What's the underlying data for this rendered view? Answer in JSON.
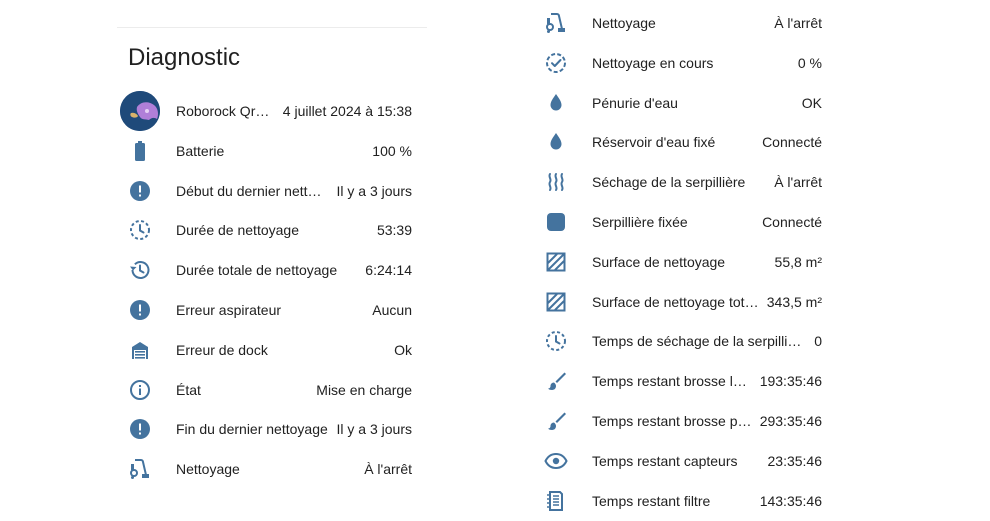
{
  "page": {
    "title": "Diagnostic"
  },
  "colors": {
    "icon": "#44739e",
    "avatar_bg": "#1f4a7a",
    "avatar_accent": "#b07fd8"
  },
  "left": {
    "items": [
      {
        "icon": "robot-avatar",
        "label": "Roborock Qrevo",
        "value": "4 juillet 2024 à 15:38"
      },
      {
        "icon": "battery-icon",
        "label": "Batterie",
        "value": "100 %"
      },
      {
        "icon": "alert-circle-icon",
        "label": "Début du dernier nettoyage",
        "value": "Il y a 3 jours"
      },
      {
        "icon": "timer-outline-icon",
        "label": "Durée de nettoyage",
        "value": "53:39"
      },
      {
        "icon": "history-icon",
        "label": "Durée totale de nettoyage",
        "value": "6:24:14"
      },
      {
        "icon": "alert-circle-icon",
        "label": "Erreur aspirateur",
        "value": "Aucun"
      },
      {
        "icon": "garage-icon",
        "label": "Erreur de dock",
        "value": "Ok"
      },
      {
        "icon": "info-outline-icon",
        "label": "État",
        "value": "Mise en charge"
      },
      {
        "icon": "alert-circle-icon",
        "label": "Fin du dernier nettoyage",
        "value": "Il y a 3 jours"
      },
      {
        "icon": "vacuum-icon",
        "label": "Nettoyage",
        "value": "À l'arrêt"
      }
    ]
  },
  "right": {
    "items": [
      {
        "icon": "vacuum-icon",
        "label": "Nettoyage",
        "value": "À l'arrêt"
      },
      {
        "icon": "progress-check-icon",
        "label": "Nettoyage en cours",
        "value": "0 %"
      },
      {
        "icon": "water-drop-icon",
        "label": "Pénurie d'eau",
        "value": "OK"
      },
      {
        "icon": "water-drop-icon",
        "label": "Réservoir d'eau fixé",
        "value": "Connecté"
      },
      {
        "icon": "heat-waves-icon",
        "label": "Séchage de la serpillière",
        "value": "À l'arrêt"
      },
      {
        "icon": "square-rounded-icon",
        "label": "Serpillière fixée",
        "value": "Connecté"
      },
      {
        "icon": "area-hatch-icon",
        "label": "Surface de nettoyage",
        "value": "55,8 m²"
      },
      {
        "icon": "area-hatch-icon",
        "label": "Surface de nettoyage totale",
        "value": "343,5 m²"
      },
      {
        "icon": "timer-outline-icon",
        "label": "Temps de séchage de la serpillière",
        "value": "0"
      },
      {
        "icon": "brush-icon",
        "label": "Temps restant brosse latérale",
        "value": "193:35:46"
      },
      {
        "icon": "brush-icon",
        "label": "Temps restant brosse principale",
        "value": "293:35:46"
      },
      {
        "icon": "eye-icon",
        "label": "Temps restant capteurs",
        "value": "23:35:46"
      },
      {
        "icon": "air-filter-icon",
        "label": "Temps restant filtre",
        "value": "143:35:46"
      }
    ]
  }
}
